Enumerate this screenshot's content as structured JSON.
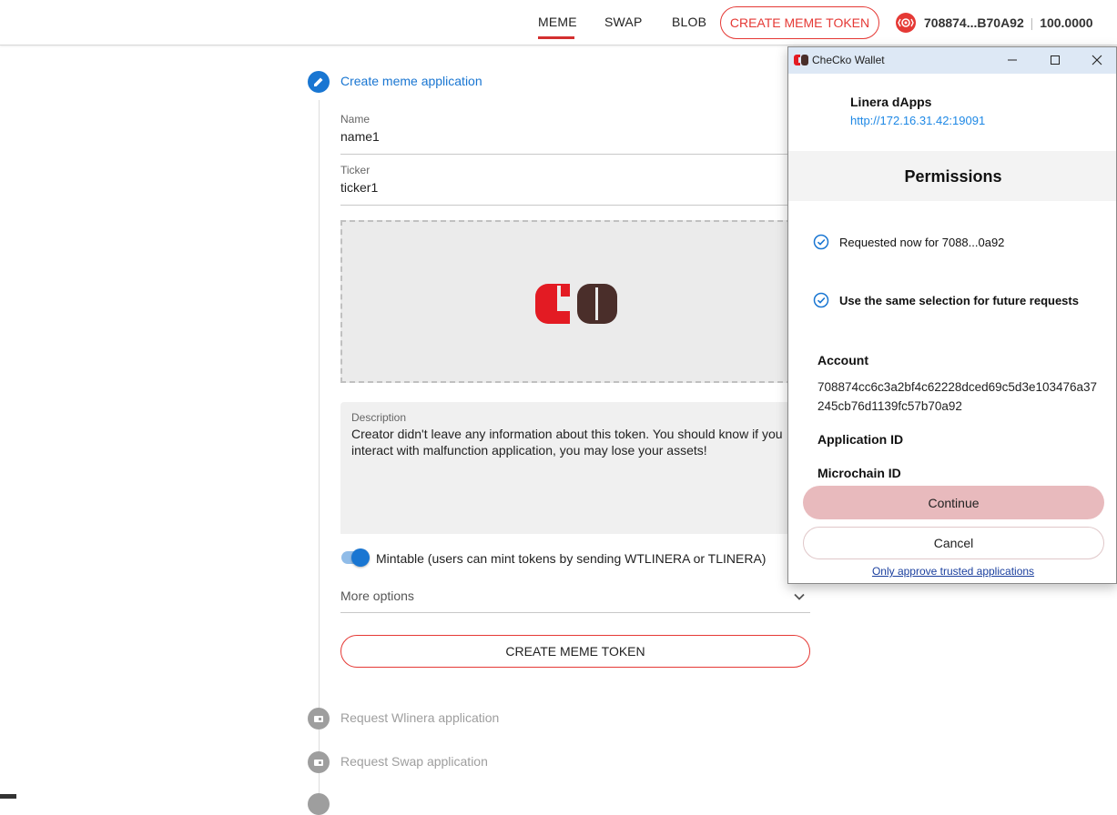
{
  "nav": {
    "items": [
      "MEME",
      "SWAP",
      "BLOB"
    ],
    "active": "MEME",
    "create_button": "CREATE MEME TOKEN",
    "account_short": "708874...B70A92",
    "balance": "100.0000",
    "accent_color": "#e53935"
  },
  "stepper": {
    "active_step": "Create meme application",
    "steps_below": [
      "Request Wlinera application",
      "Request Swap application"
    ]
  },
  "form": {
    "name_label": "Name",
    "name_value": "name1",
    "ticker_label": "Ticker",
    "ticker_value": "ticker1",
    "description_label": "Description",
    "description_value": "Creator didn't leave any information about this token. You should know if you interact with malfunction application, you may lose your assets!",
    "mintable_label": "Mintable (users can mint tokens by sending WTLINERA or TLINERA)",
    "mintable_on": true,
    "more_options": "More options",
    "submit_button": "CREATE MEME TOKEN"
  },
  "wallet": {
    "window_title": "CheCko Wallet",
    "dapp_name": "Linera dApps",
    "dapp_url": "http://172.16.31.42:19091",
    "permissions_title": "Permissions",
    "check_requested": "Requested now for 7088...0a92",
    "check_same_selection": "Use the same selection for future requests",
    "account_label": "Account",
    "account_value": "708874cc6c3a2bf4c62228dced69c5d3e103476a37245cb76d1139fc57b70a92",
    "application_id_label": "Application ID",
    "microchain_id_label": "Microchain ID",
    "continue_button": "Continue",
    "cancel_button": "Cancel",
    "trusted_link": "Only approve trusted applications"
  }
}
